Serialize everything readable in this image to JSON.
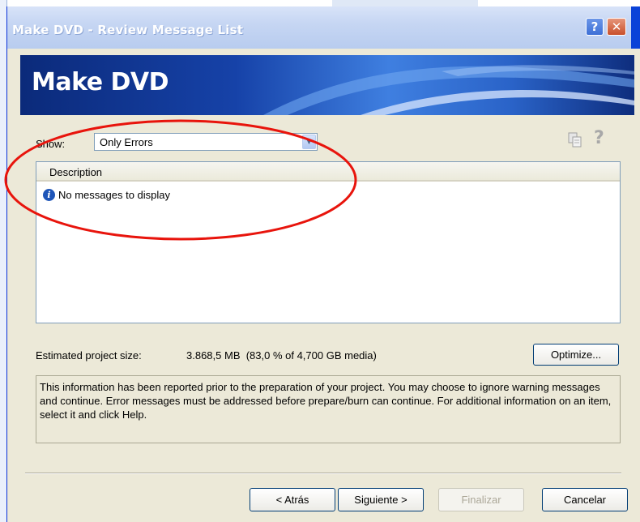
{
  "window": {
    "title": "Make DVD - Review Message List",
    "help_button": "?",
    "close_button": "✕"
  },
  "banner": {
    "title": "Make DVD"
  },
  "filter": {
    "label": "Show:",
    "value": "Only Errors"
  },
  "toolbar": {
    "help_glyph": "?"
  },
  "message_list": {
    "columns": [
      "Description"
    ],
    "rows": [
      {
        "icon": "info-icon",
        "text": "No messages to display"
      }
    ]
  },
  "project_size": {
    "label": "Estimated project size:",
    "value": "3.868,5 MB  (83,0 % of 4,700 GB media)",
    "optimize_label": "Optimize..."
  },
  "info_text": "This information has been reported prior to the preparation of your project.  You may choose to ignore warning messages and continue.  Error messages must be addressed before prepare/burn can continue.  For additional information on an item, select it and click Help.",
  "buttons": {
    "back": "< Atrás",
    "next": "Siguiente >",
    "finish": "Finalizar",
    "cancel": "Cancelar"
  },
  "colors": {
    "annotation_circle": "#e8140c",
    "banner_dark": "#0b2a7a",
    "dialog_bg": "#ece9d8"
  }
}
